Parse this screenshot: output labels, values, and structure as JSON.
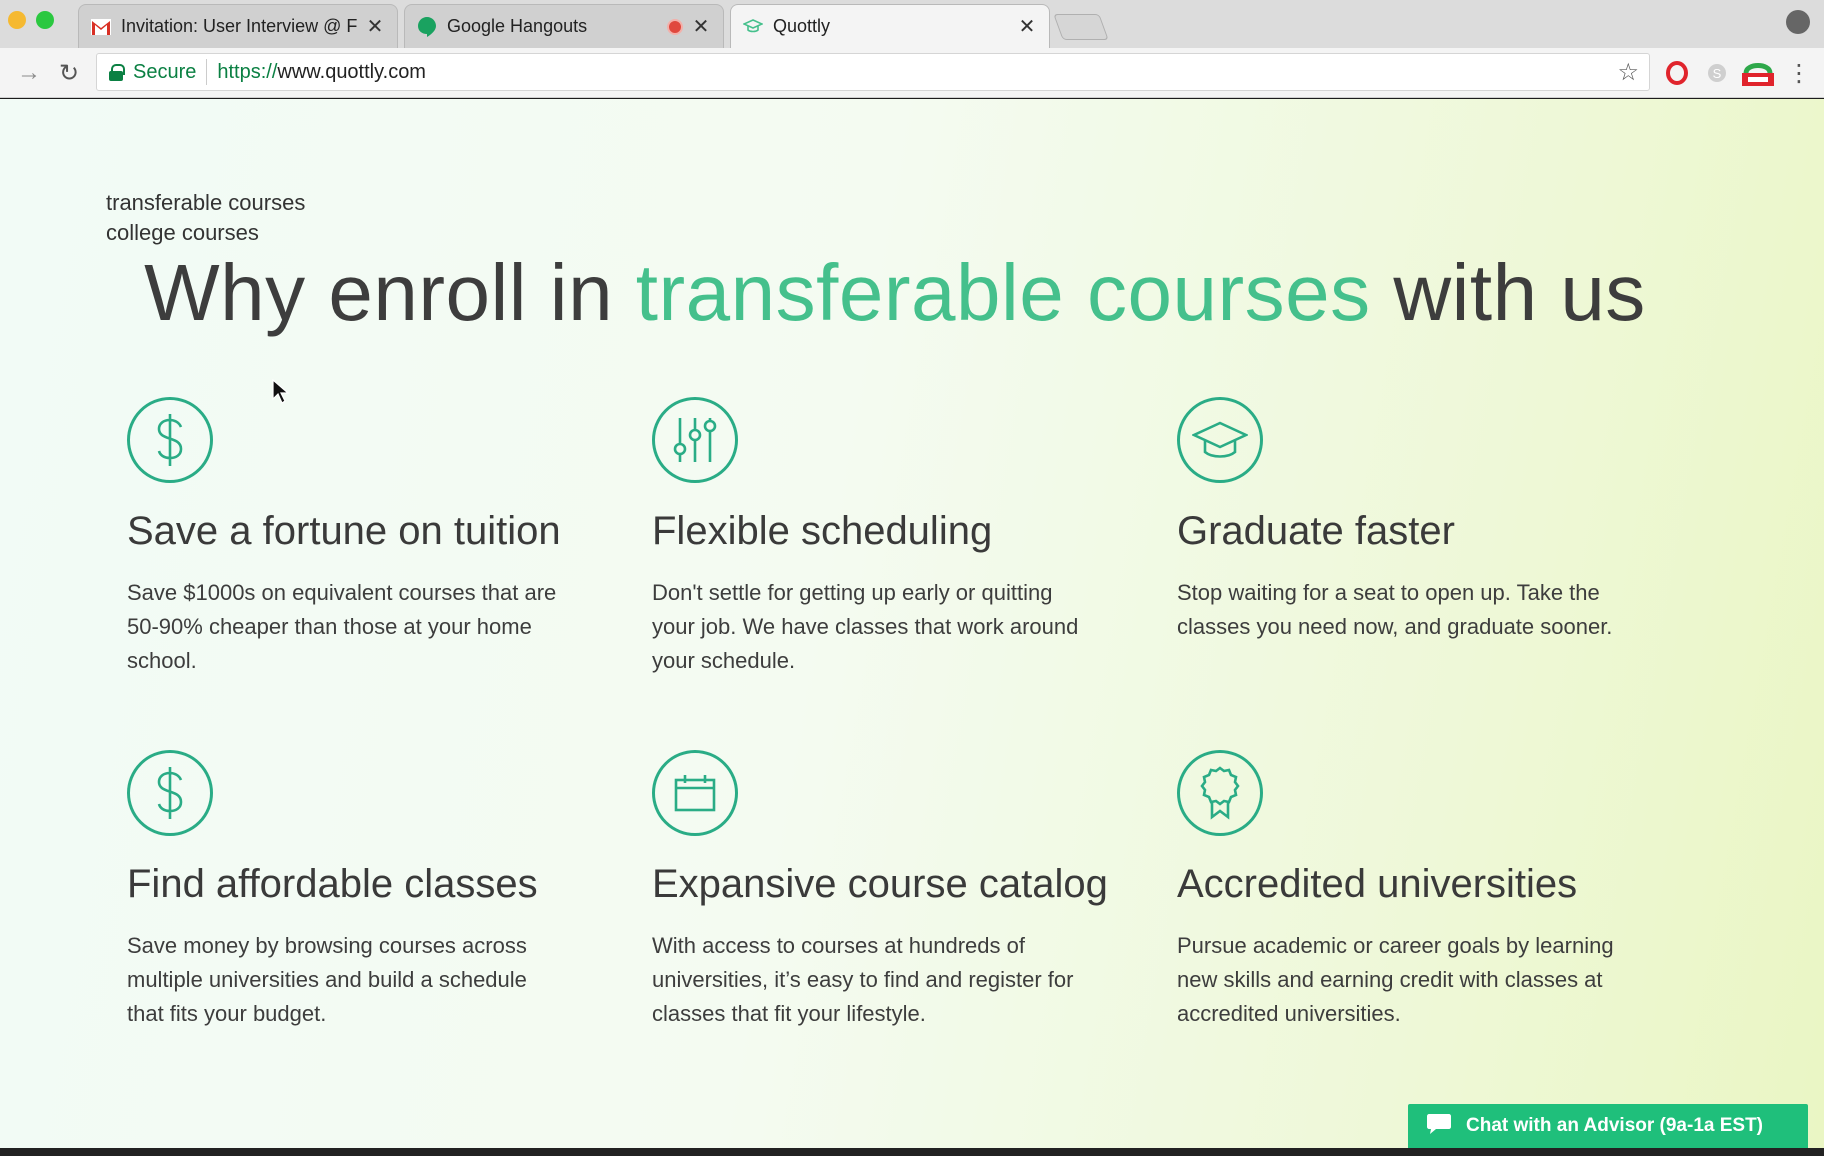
{
  "browser": {
    "tabs": [
      {
        "title": "Invitation: User Interview @ Fri",
        "favicon": "gmail-icon"
      },
      {
        "title": "Google Hangouts",
        "favicon": "hangouts-icon",
        "recording": true
      },
      {
        "title": "Quottly",
        "favicon": "quottly-cap-icon",
        "active": true
      }
    ],
    "omnibox": {
      "secure_label": "Secure",
      "url_scheme": "https://",
      "url_host": "www.quottly.com"
    }
  },
  "page": {
    "keywords": [
      "transferable courses",
      "college courses"
    ],
    "headline": {
      "before": "Why enroll in ",
      "accent": "transferable courses",
      "after": " with us"
    },
    "accent_color": "#45c08c",
    "icon_color": "#2aac86",
    "features": [
      {
        "icon": "dollar-icon",
        "title": "Save a fortune on tuition",
        "description": "Save $1000s on equivalent courses that are 50-90% cheaper than those at your home school."
      },
      {
        "icon": "sliders-icon",
        "title": "Flexible scheduling",
        "description": "Don't settle for getting up early or quitting your job. We have classes that work around your schedule."
      },
      {
        "icon": "graduation-cap-icon",
        "title": "Graduate faster",
        "description": "Stop waiting for a seat to open up. Take the classes you need now, and graduate sooner."
      },
      {
        "icon": "dollar-icon",
        "title": "Find affordable classes",
        "description": "Save money by browsing courses across multiple universities and build a schedule that fits your budget."
      },
      {
        "icon": "calendar-icon",
        "title": "Expansive course catalog",
        "description": "With access to courses at hundreds of universities, it’s easy to find and register for classes that fit your lifestyle."
      },
      {
        "icon": "award-ribbon-icon",
        "title": "Accredited universities",
        "description": "Pursue academic or career goals by learning new skills and earning credit with classes at accredited universities."
      }
    ],
    "chat": {
      "label": "Chat with an Advisor (9a-1a EST)",
      "color": "#1fbf7b"
    }
  }
}
